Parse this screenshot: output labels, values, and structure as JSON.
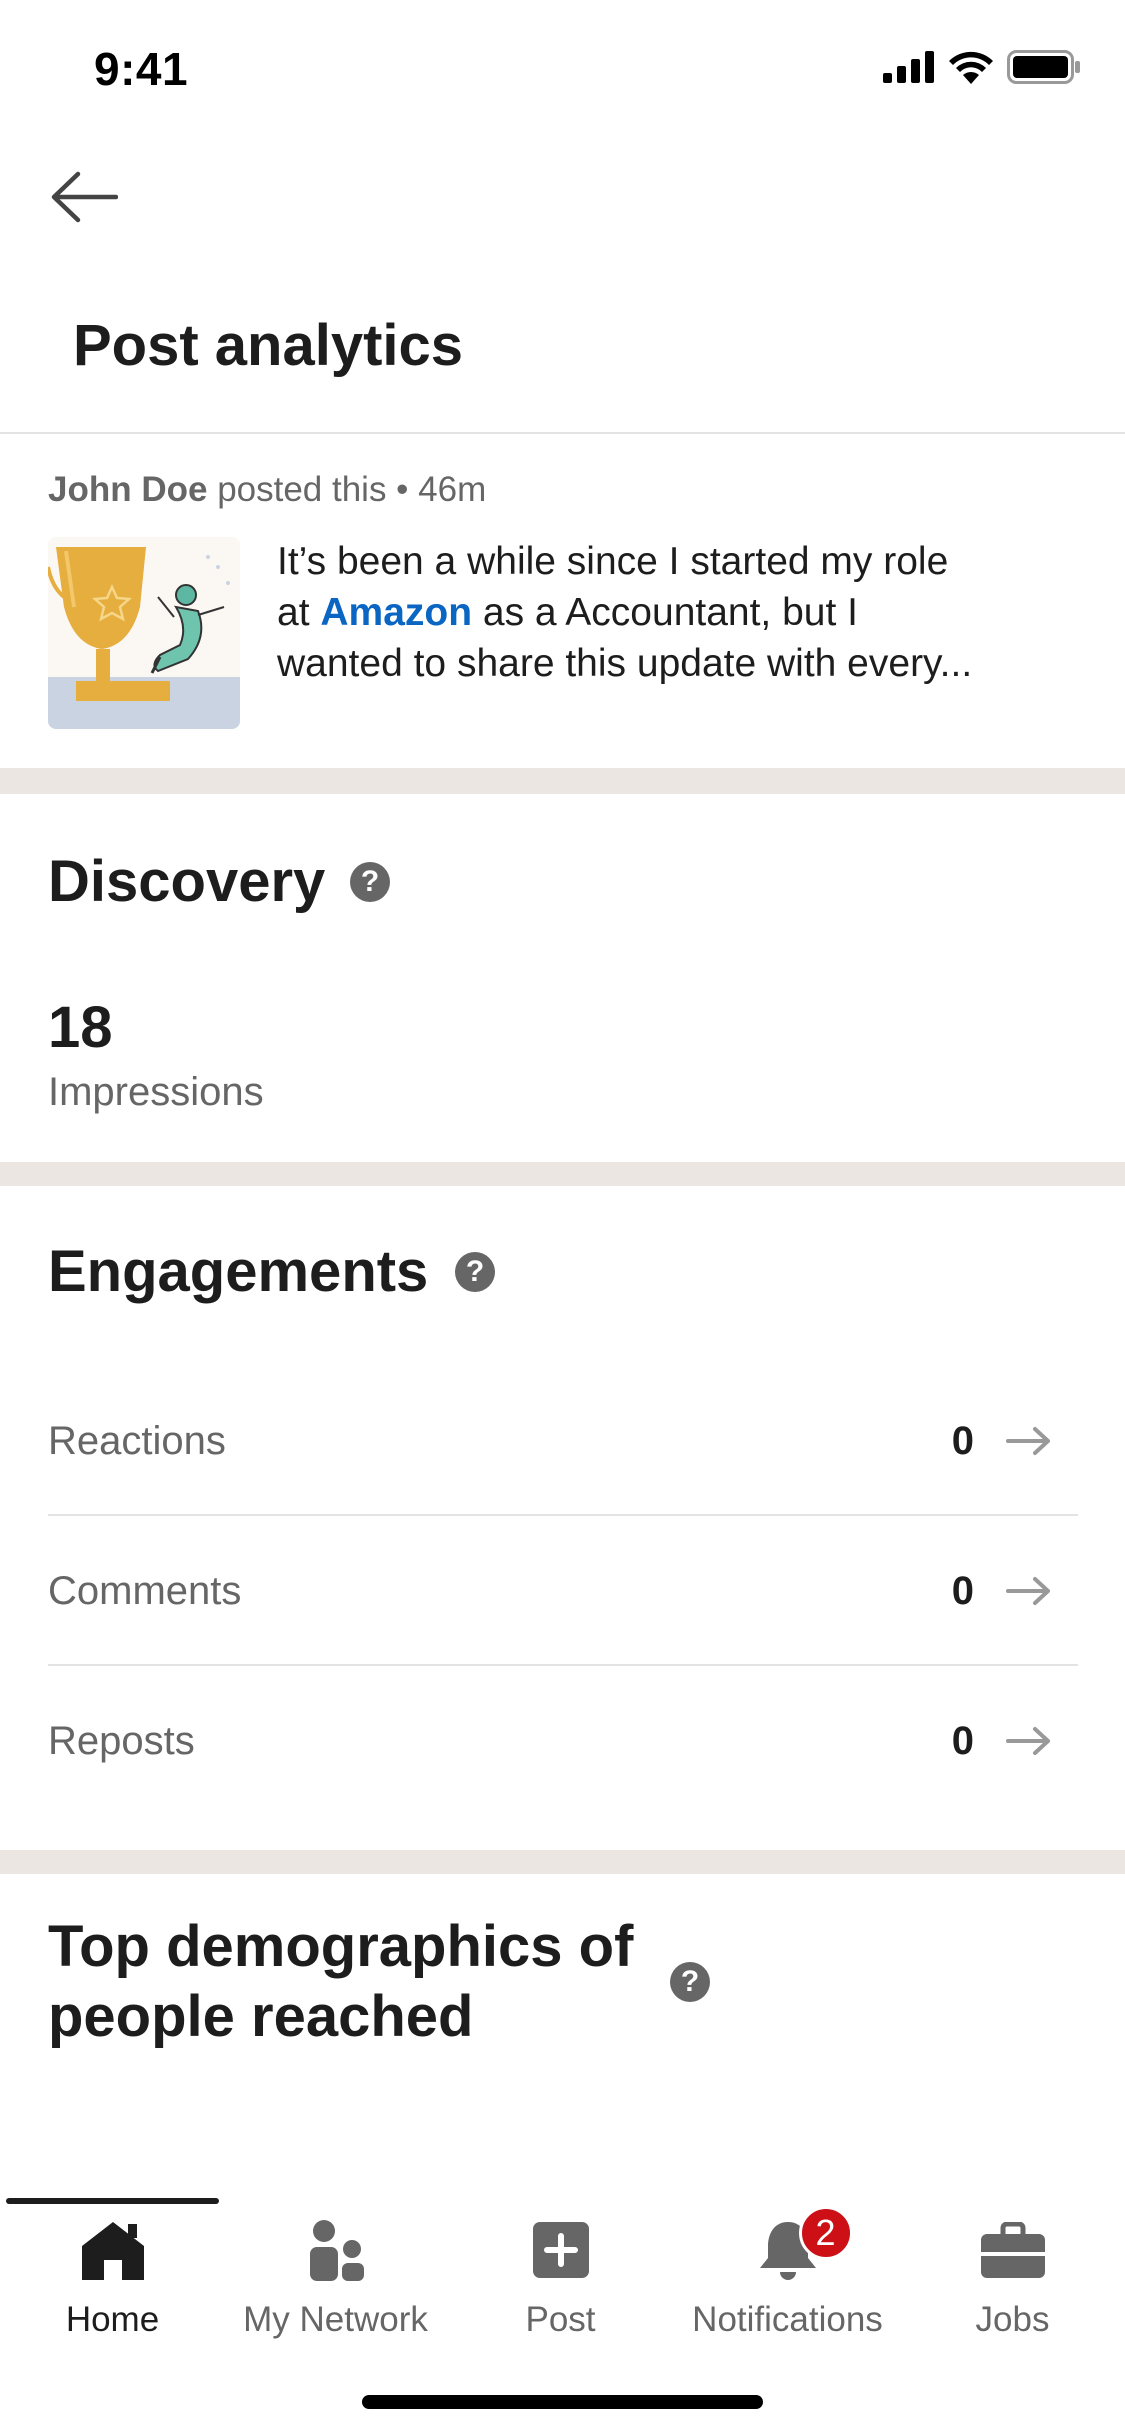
{
  "status_bar": {
    "time": "9:41"
  },
  "header": {
    "title": "Post analytics"
  },
  "post": {
    "author": "John Doe",
    "meta_suffix": "posted this • 46m",
    "text_line1": "It’s been a while since I started my role",
    "text_line2_prefix": "at ",
    "mention": "Amazon",
    "text_line2_suffix": " as a Accountant, but I",
    "text_line3": "wanted to share this update with every..."
  },
  "discovery": {
    "heading": "Discovery",
    "impressions_value": "18",
    "impressions_label": "Impressions"
  },
  "engagements": {
    "heading": "Engagements",
    "rows": [
      {
        "label": "Reactions",
        "value": "0"
      },
      {
        "label": "Comments",
        "value": "0"
      },
      {
        "label": "Reposts",
        "value": "0"
      }
    ]
  },
  "demographics": {
    "heading": "Top demographics of people reached"
  },
  "help_glyph": "?",
  "bottom_nav": {
    "items": [
      {
        "label": "Home",
        "icon": "home-icon",
        "active": true
      },
      {
        "label": "My Network",
        "icon": "network-icon"
      },
      {
        "label": "Post",
        "icon": "plus-square-icon"
      },
      {
        "label": "Notifications",
        "icon": "bell-icon",
        "badge": "2"
      },
      {
        "label": "Jobs",
        "icon": "briefcase-icon"
      }
    ]
  },
  "colors": {
    "accent": "#0a66c2",
    "badge": "#cc1016",
    "section_gap": "#ebe6e1"
  }
}
